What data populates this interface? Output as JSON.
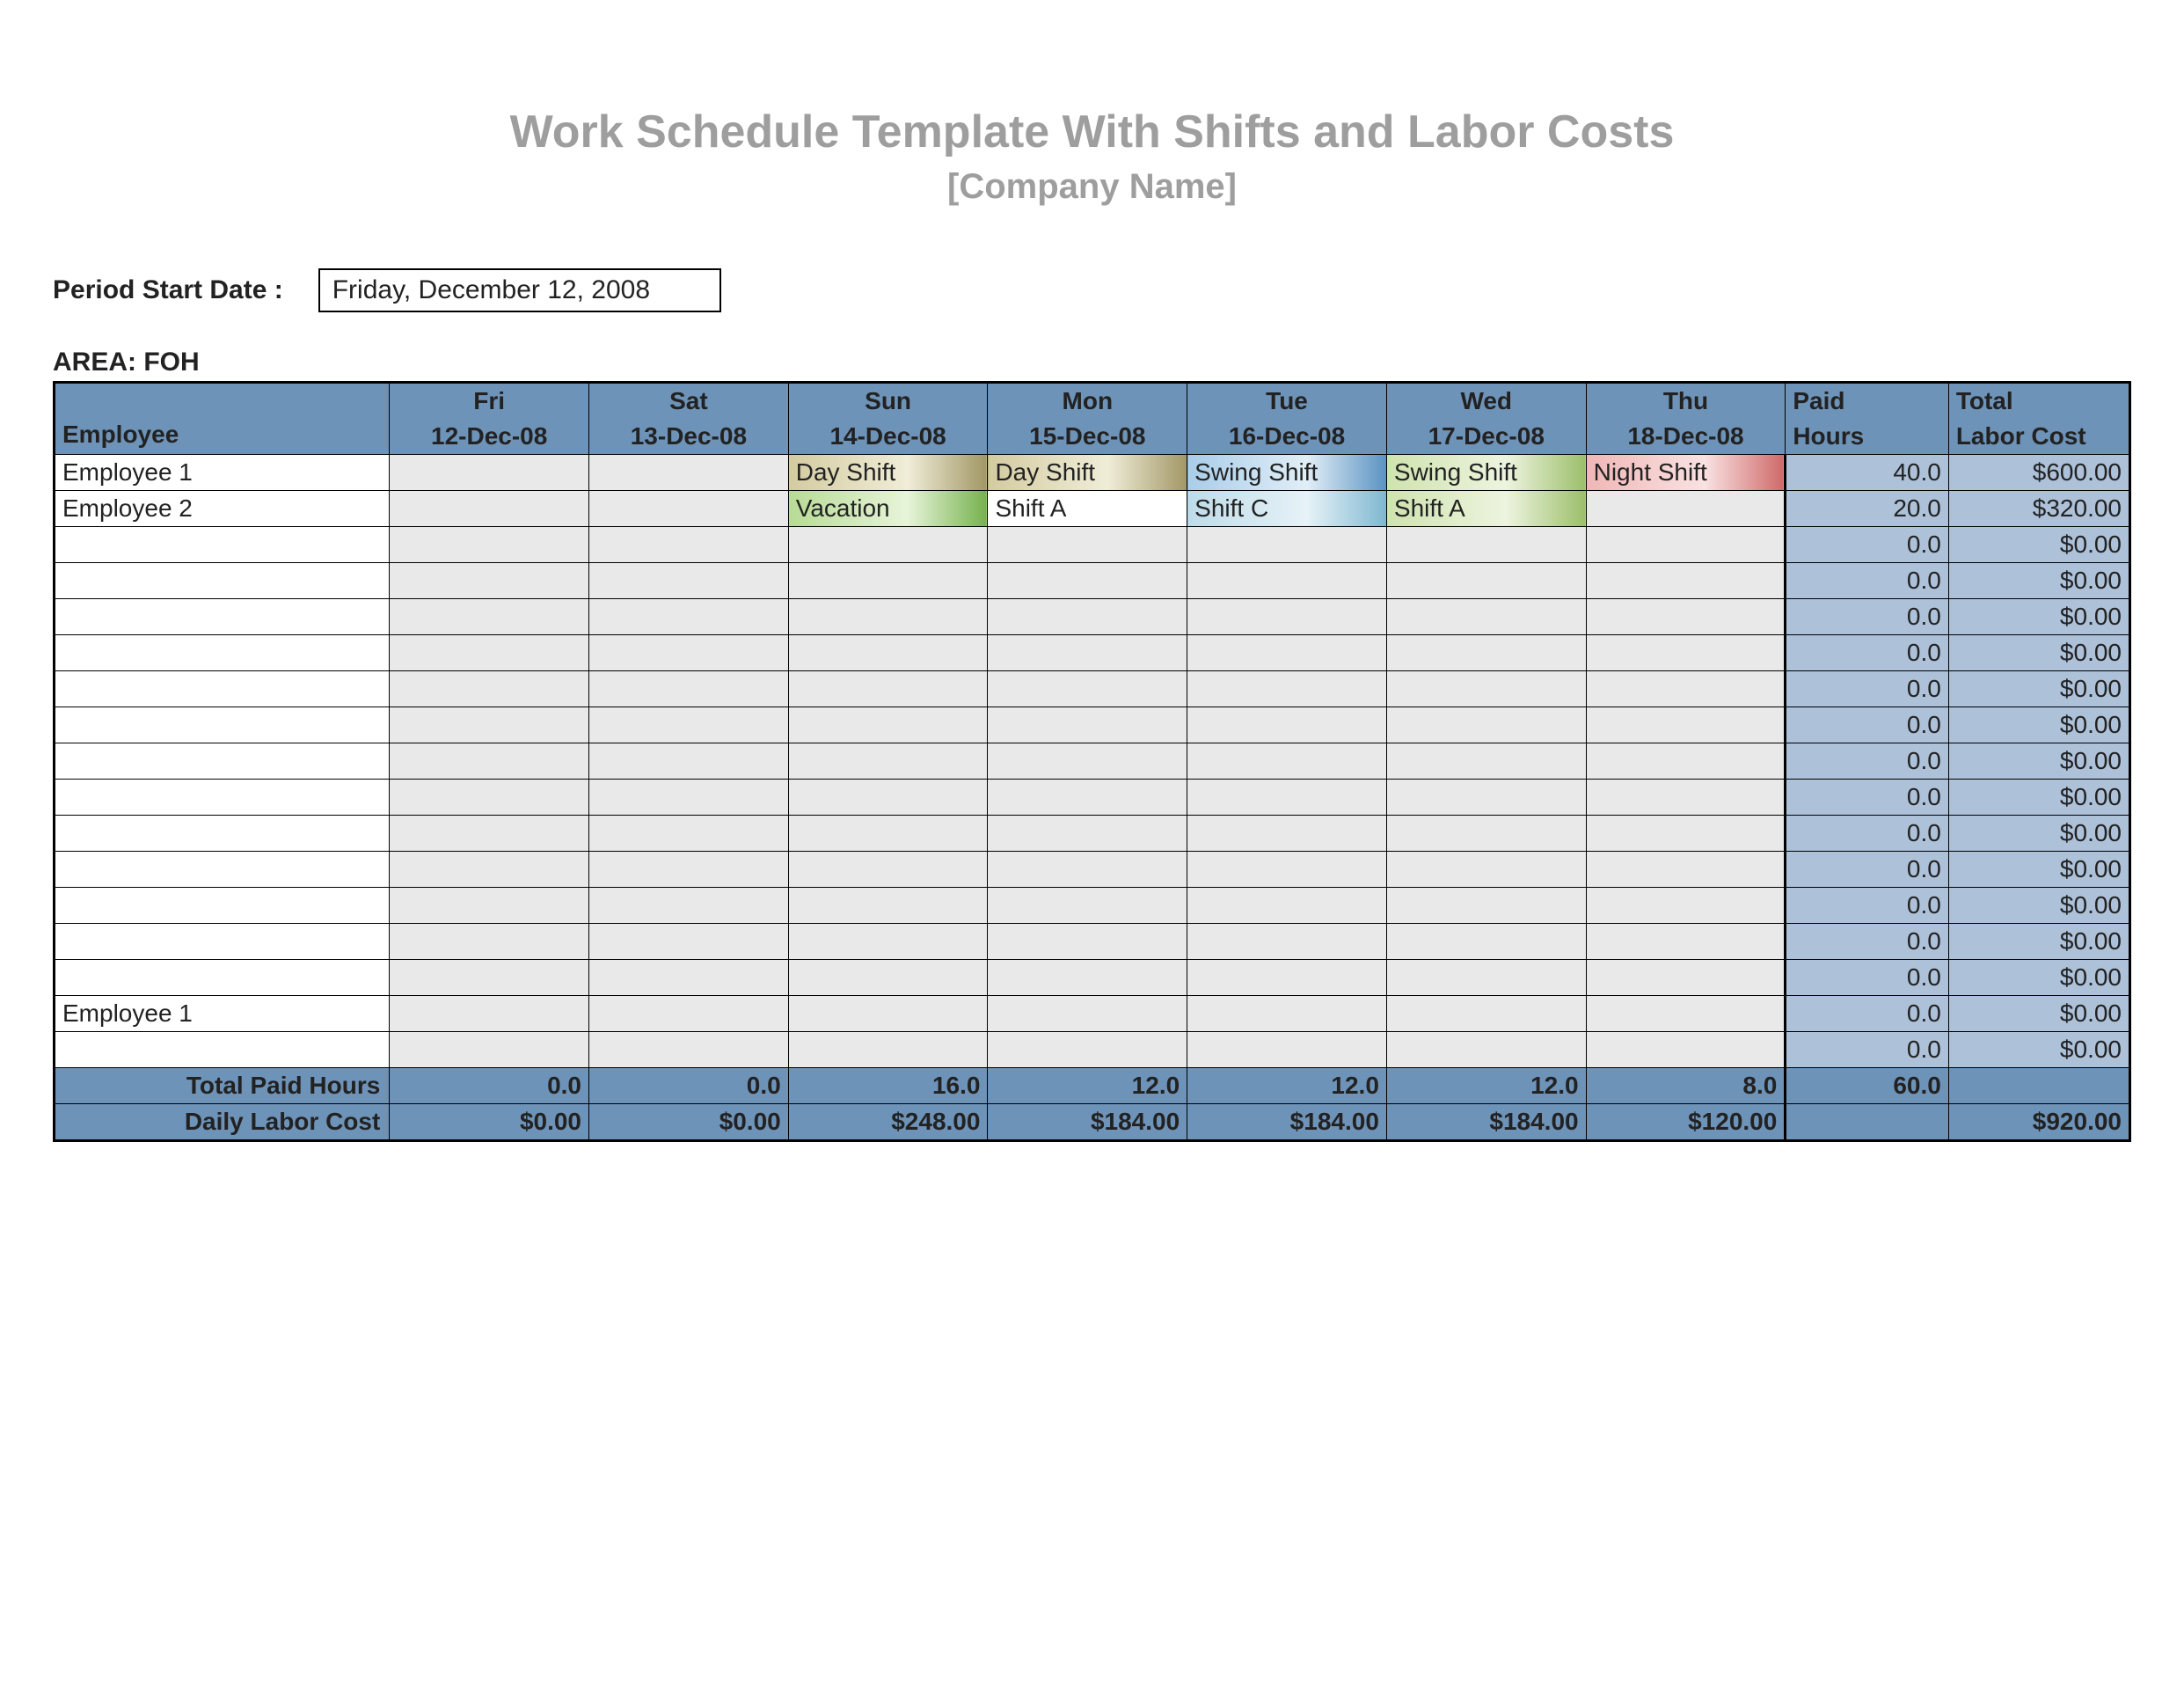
{
  "title": "Work Schedule Template With Shifts and Labor Costs",
  "subtitle": "[Company Name]",
  "period": {
    "label": "Period Start Date :",
    "value": "Friday, December 12, 2008"
  },
  "area": {
    "label": "AREA: FOH"
  },
  "table": {
    "headers": {
      "employee": "Employee",
      "paid_hours_1": "Paid",
      "paid_hours_2": "Hours",
      "labor_cost_1": "Total",
      "labor_cost_2": "Labor Cost",
      "days": [
        {
          "dow": "Fri",
          "date": "12-Dec-08"
        },
        {
          "dow": "Sat",
          "date": "13-Dec-08"
        },
        {
          "dow": "Sun",
          "date": "14-Dec-08"
        },
        {
          "dow": "Mon",
          "date": "15-Dec-08"
        },
        {
          "dow": "Tue",
          "date": "16-Dec-08"
        },
        {
          "dow": "Wed",
          "date": "17-Dec-08"
        },
        {
          "dow": "Thu",
          "date": "18-Dec-08"
        }
      ]
    },
    "rows": [
      {
        "name": "Employee 1",
        "cells": [
          null,
          null,
          {
            "text": "Day Shift",
            "color": "olive"
          },
          {
            "text": "Day Shift",
            "color": "olive"
          },
          {
            "text": "Swing Shift",
            "color": "blue"
          },
          {
            "text": "Swing Shift",
            "color": "lime"
          },
          {
            "text": "Night Shift",
            "color": "red"
          }
        ],
        "paid_hours": "40.0",
        "labor_cost": "$600.00"
      },
      {
        "name": "Employee 2",
        "cells": [
          null,
          null,
          {
            "text": "Vacation",
            "color": "green"
          },
          {
            "text": "Shift A",
            "color": "plain"
          },
          {
            "text": "Shift C",
            "color": "sky"
          },
          {
            "text": "Shift A",
            "color": "lime"
          },
          null
        ],
        "paid_hours": "20.0",
        "labor_cost": "$320.00"
      },
      {
        "name": "",
        "cells": [
          null,
          null,
          null,
          null,
          null,
          null,
          null
        ],
        "paid_hours": "0.0",
        "labor_cost": "$0.00"
      },
      {
        "name": "",
        "cells": [
          null,
          null,
          null,
          null,
          null,
          null,
          null
        ],
        "paid_hours": "0.0",
        "labor_cost": "$0.00"
      },
      {
        "name": "",
        "cells": [
          null,
          null,
          null,
          null,
          null,
          null,
          null
        ],
        "paid_hours": "0.0",
        "labor_cost": "$0.00"
      },
      {
        "name": "",
        "cells": [
          null,
          null,
          null,
          null,
          null,
          null,
          null
        ],
        "paid_hours": "0.0",
        "labor_cost": "$0.00"
      },
      {
        "name": "",
        "cells": [
          null,
          null,
          null,
          null,
          null,
          null,
          null
        ],
        "paid_hours": "0.0",
        "labor_cost": "$0.00"
      },
      {
        "name": "",
        "cells": [
          null,
          null,
          null,
          null,
          null,
          null,
          null
        ],
        "paid_hours": "0.0",
        "labor_cost": "$0.00"
      },
      {
        "name": "",
        "cells": [
          null,
          null,
          null,
          null,
          null,
          null,
          null
        ],
        "paid_hours": "0.0",
        "labor_cost": "$0.00"
      },
      {
        "name": "",
        "cells": [
          null,
          null,
          null,
          null,
          null,
          null,
          null
        ],
        "paid_hours": "0.0",
        "labor_cost": "$0.00"
      },
      {
        "name": "",
        "cells": [
          null,
          null,
          null,
          null,
          null,
          null,
          null
        ],
        "paid_hours": "0.0",
        "labor_cost": "$0.00"
      },
      {
        "name": "",
        "cells": [
          null,
          null,
          null,
          null,
          null,
          null,
          null
        ],
        "paid_hours": "0.0",
        "labor_cost": "$0.00"
      },
      {
        "name": "",
        "cells": [
          null,
          null,
          null,
          null,
          null,
          null,
          null
        ],
        "paid_hours": "0.0",
        "labor_cost": "$0.00"
      },
      {
        "name": "",
        "cells": [
          null,
          null,
          null,
          null,
          null,
          null,
          null
        ],
        "paid_hours": "0.0",
        "labor_cost": "$0.00"
      },
      {
        "name": "",
        "cells": [
          null,
          null,
          null,
          null,
          null,
          null,
          null
        ],
        "paid_hours": "0.0",
        "labor_cost": "$0.00"
      },
      {
        "name": "Employee 1",
        "cells": [
          null,
          null,
          null,
          null,
          null,
          null,
          null
        ],
        "paid_hours": "0.0",
        "labor_cost": "$0.00"
      },
      {
        "name": "",
        "cells": [
          null,
          null,
          null,
          null,
          null,
          null,
          null
        ],
        "paid_hours": "0.0",
        "labor_cost": "$0.00"
      }
    ],
    "footer": {
      "total_paid_hours": {
        "label": "Total Paid Hours",
        "per_day": [
          "0.0",
          "0.0",
          "16.0",
          "12.0",
          "12.0",
          "12.0",
          "8.0"
        ],
        "total": "60.0"
      },
      "daily_labor_cost": {
        "label": "Daily Labor Cost",
        "per_day": [
          "$0.00",
          "$0.00",
          "$248.00",
          "$184.00",
          "$184.00",
          "$184.00",
          "$120.00"
        ],
        "total": "$920.00"
      }
    }
  }
}
